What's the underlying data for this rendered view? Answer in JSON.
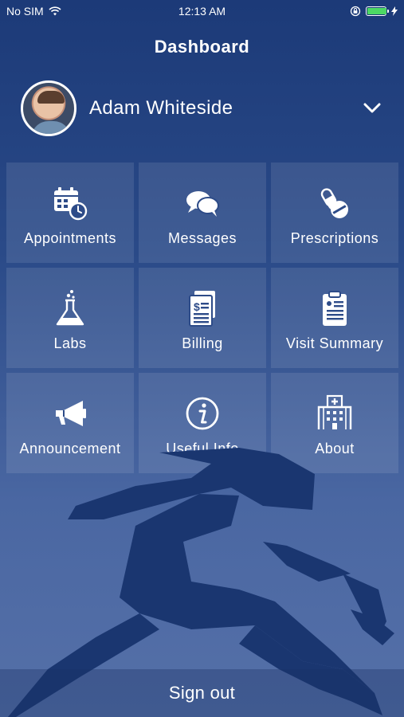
{
  "status_bar": {
    "carrier": "No SIM",
    "time": "12:13 AM",
    "wifi_icon": "wifi-icon",
    "lock_icon": "rotation-lock-icon",
    "battery_icon": "battery-icon",
    "charging_icon": "charging-bolt-icon",
    "battery_level": 1.0
  },
  "header": {
    "title": "Dashboard"
  },
  "user": {
    "name": "Adam Whiteside",
    "avatar_icon": "avatar",
    "expand_icon": "chevron-down-icon"
  },
  "tiles": [
    {
      "label": "Appointments",
      "icon": "calendar-clock-icon"
    },
    {
      "label": "Messages",
      "icon": "chat-bubbles-icon"
    },
    {
      "label": "Prescriptions",
      "icon": "pills-icon"
    },
    {
      "label": "Labs",
      "icon": "flask-icon"
    },
    {
      "label": "Billing",
      "icon": "bill-icon"
    },
    {
      "label": "Visit Summary",
      "icon": "clipboard-icon"
    },
    {
      "label": "Announcement",
      "icon": "megaphone-icon"
    },
    {
      "label": "Useful Info",
      "icon": "info-icon"
    },
    {
      "label": "About",
      "icon": "hospital-icon"
    }
  ],
  "footer": {
    "signout_label": "Sign out"
  },
  "colors": {
    "background_top": "#1c3a78",
    "background_bottom": "#5570a8",
    "runner": "#1a3670",
    "battery": "#4cd964"
  }
}
